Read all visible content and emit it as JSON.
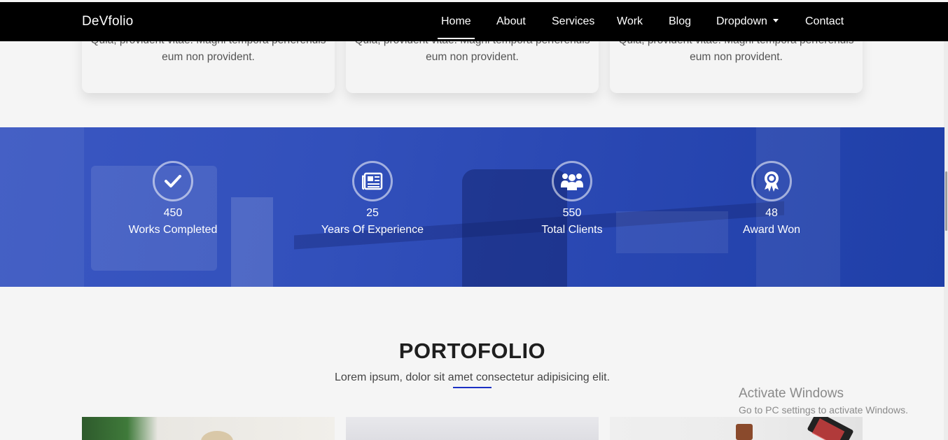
{
  "navbar": {
    "brand": "DeVfolio",
    "items": [
      {
        "label": "Home",
        "active": true
      },
      {
        "label": "About"
      },
      {
        "label": "Services"
      },
      {
        "label": "Work"
      },
      {
        "label": "Blog"
      },
      {
        "label": "Dropdown"
      },
      {
        "label": "Contact"
      }
    ]
  },
  "services": {
    "cards": [
      {
        "text_line1": "Quia, provident vitae. Magni tempora perferendis",
        "text_line2": "eum non provident."
      },
      {
        "text_line1": "Quia, provident vitae. Magni tempora perferendis",
        "text_line2": "eum non provident."
      },
      {
        "text_line1": "Quia, provident vitae. Magni tempora perferendis",
        "text_line2": "eum non provident."
      }
    ]
  },
  "counters": [
    {
      "icon": "checkmark-icon",
      "number": "450",
      "label": "Works Completed"
    },
    {
      "icon": "newspaper-icon",
      "number": "25",
      "label": "Years Of Experience"
    },
    {
      "icon": "people-icon",
      "number": "550",
      "label": "Total Clients"
    },
    {
      "icon": "award-icon",
      "number": "48",
      "label": "Award Won"
    }
  ],
  "portfolio": {
    "title": "PORTOFOLIO",
    "subtitle": "Lorem ipsum, dolor sit amet consectetur adipisicing elit.",
    "accent_color": "#1b2fc4"
  },
  "os_overlay": {
    "title": "Activate Windows",
    "message": "Go to PC settings to activate Windows."
  },
  "colors": {
    "navbar_bg": "#000000",
    "counter_overlay": "#2a48b3",
    "page_bg": "#f5f5f5"
  }
}
